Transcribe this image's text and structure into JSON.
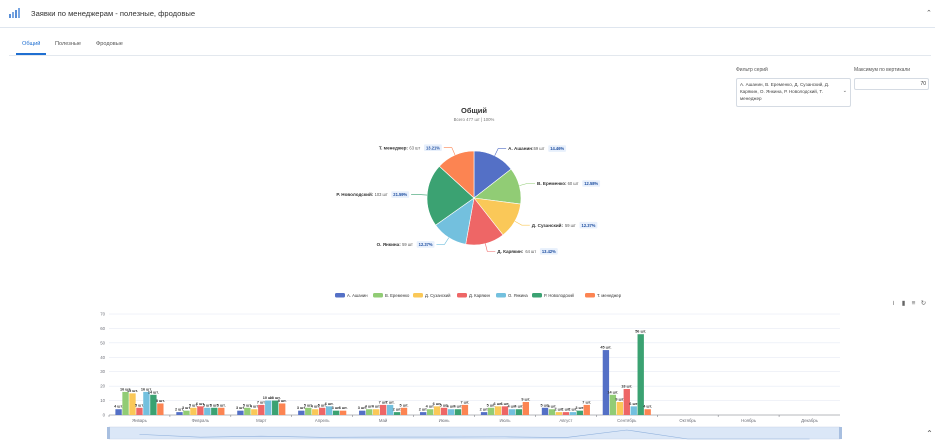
{
  "header": {
    "title": "Заявки по менеджерам - полезные, фродовые",
    "logo_icon": "bar-chart-icon",
    "collapse_icon": "chevron-up-icon"
  },
  "tabs": [
    {
      "label": "Общий",
      "active": true
    },
    {
      "label": "Полезные",
      "active": false
    },
    {
      "label": "Фродовые",
      "active": false
    }
  ],
  "filter": {
    "label": "Фильтр серий",
    "value": "А. Ашанин, В. Еременко, Д. Сузанский, Д. Карякин, О. Янкина, Р. Новолодский, Т. менеджер",
    "chevron_icon": "chevron-down-icon"
  },
  "max_vertical": {
    "label": "Максимум по вертикали",
    "value": "70"
  },
  "colors": [
    "#5470c6",
    "#91cc75",
    "#fac858",
    "#ee6666",
    "#73c0de",
    "#3ba272",
    "#fc8452"
  ],
  "toolbox_icons": [
    "line-chart-icon",
    "bar-chart-icon",
    "stack-icon",
    "restore-icon"
  ],
  "scroll_top_icon": "double-chevron-up-icon",
  "chart_data": [
    {
      "type": "pie",
      "title": "Общий",
      "subtitle": "Всего 477 шт | 100%",
      "slices": [
        {
          "name": "А. Ашанин",
          "value": 69,
          "percent": "14.46%"
        },
        {
          "name": "В. Еременко",
          "value": 60,
          "percent": "12.58%"
        },
        {
          "name": "Д. Сузанский",
          "value": 59,
          "percent": "12.37%"
        },
        {
          "name": "Д. Карякин",
          "value": 64,
          "percent": "13.42%"
        },
        {
          "name": "О. Янкина",
          "value": 59,
          "percent": "12.37%"
        },
        {
          "name": "Р. Новолодский",
          "value": 103,
          "percent": "21.59%"
        },
        {
          "name": "Т. менеджер",
          "value": 63,
          "percent": "13.21%"
        }
      ]
    },
    {
      "type": "bar",
      "categories": [
        "Январь",
        "Февраль",
        "Март",
        "Апрель",
        "Май",
        "Июнь",
        "Июль",
        "Август",
        "Сентябрь",
        "Октябрь",
        "Ноябрь",
        "Декабрь"
      ],
      "ylim": [
        0,
        70
      ],
      "yticks": [
        0,
        10,
        20,
        30,
        40,
        50,
        60,
        70
      ],
      "legend_position": "top-center",
      "series": [
        {
          "name": "А. Ашанин",
          "values": [
            4,
            2,
            3,
            3,
            3,
            2,
            2,
            5,
            45,
            0,
            0,
            0
          ]
        },
        {
          "name": "В. Еременко",
          "values": [
            16,
            3,
            5,
            5,
            4,
            4,
            5,
            4,
            14,
            0,
            0,
            0
          ]
        },
        {
          "name": "Д. Сузанский",
          "values": [
            15,
            5,
            4,
            4,
            4,
            6,
            6,
            2,
            9,
            0,
            0,
            0
          ]
        },
        {
          "name": "Д. Карякин",
          "values": [
            5,
            6,
            7,
            5,
            7,
            5,
            6,
            2,
            18,
            0,
            0,
            0
          ]
        },
        {
          "name": "О. Янкина",
          "values": [
            16,
            5,
            10,
            6,
            7,
            4,
            4,
            2,
            6,
            0,
            0,
            0
          ]
        },
        {
          "name": "Р. Новолодский",
          "values": [
            14,
            5,
            10,
            3,
            2,
            4,
            4,
            3,
            56,
            0,
            0,
            0
          ]
        },
        {
          "name": "Т. менеджер",
          "values": [
            8,
            5,
            8,
            3,
            5,
            7,
            9,
            7,
            4,
            0,
            0,
            0
          ]
        }
      ]
    }
  ]
}
